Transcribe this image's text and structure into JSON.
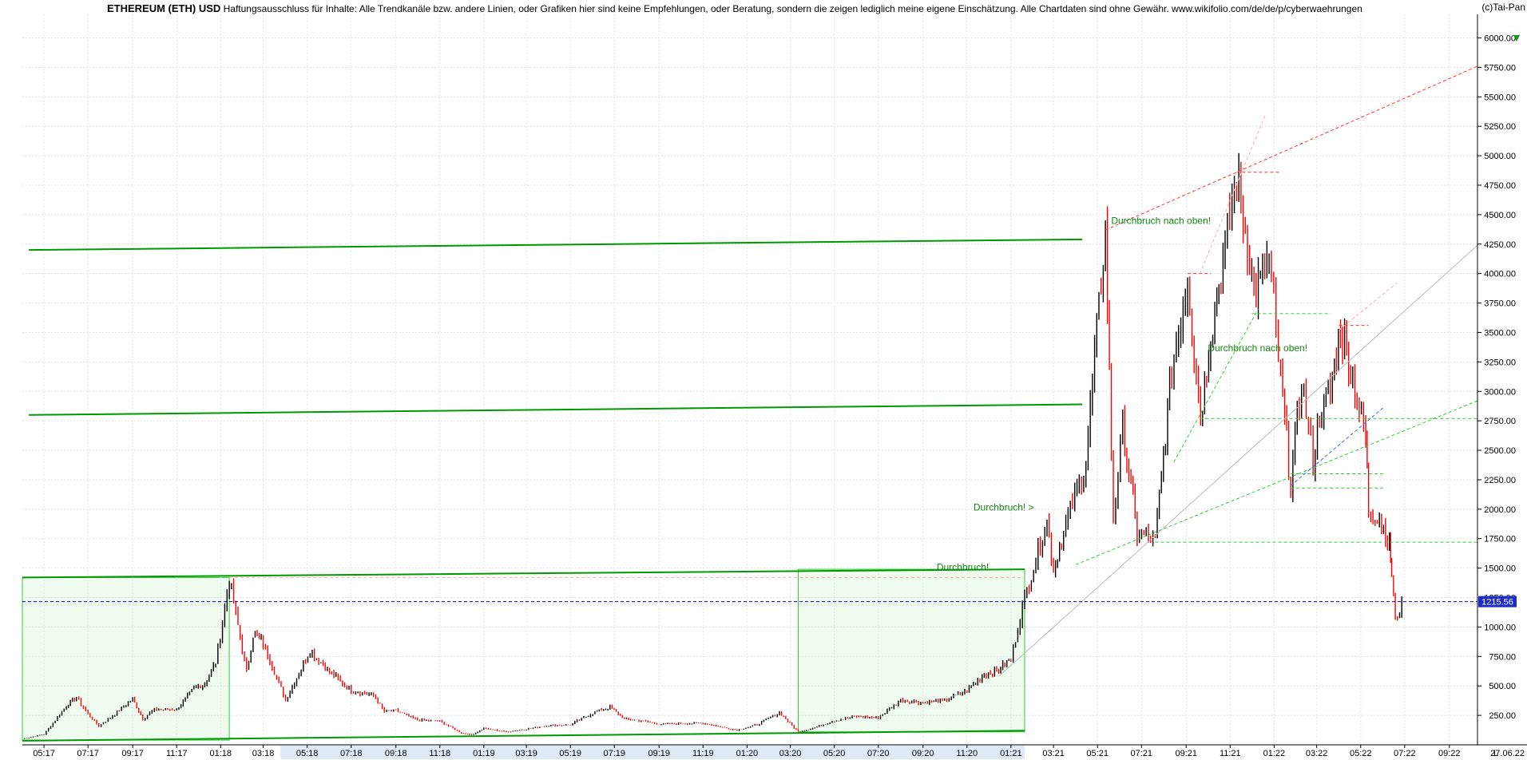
{
  "header": {
    "title": "ETHEREUM (ETH) USD",
    "disclaimer": "Haftungsausschluss für Inhalte: Alle Trendkanäle bzw. andere Linien, oder Grafiken hier sind keine Empfehlungen, oder Beratung, sondern die zeigen lediglich meine eigene Einschätzung. Alle Chartdaten sind ohne Gewähr.  www.wikifolio.com/de/de/p/cyberwaehrungen",
    "copyright": "(c)Tai-Pan"
  },
  "chart_data": {
    "type": "candlestick",
    "title": "ETHEREUM (ETH) USD",
    "ylim": [
      0,
      6200
    ],
    "y_ticks": [
      "250.00",
      "500.00",
      "750.00",
      "1000.00",
      "1250.00",
      "1500.00",
      "1750.00",
      "2000.00",
      "2250.00",
      "2500.00",
      "2750.00",
      "3000.00",
      "3250.00",
      "3500.00",
      "3750.00",
      "4000.00",
      "4250.00",
      "4500.00",
      "4750.00",
      "5000.00",
      "5250.00",
      "5500.00",
      "5750.00",
      "6000.00"
    ],
    "x_range": [
      "2017-04-01",
      "2022-10-10"
    ],
    "x_ticks": [
      {
        "label": "05:17",
        "date": "2017-05-01"
      },
      {
        "label": "07:17",
        "date": "2017-07-01"
      },
      {
        "label": "09:17",
        "date": "2017-09-01"
      },
      {
        "label": "11:17",
        "date": "2017-11-01"
      },
      {
        "label": "01:18",
        "date": "2018-01-01"
      },
      {
        "label": "03:18",
        "date": "2018-03-01"
      },
      {
        "label": "05:18",
        "date": "2018-05-01"
      },
      {
        "label": "07:18",
        "date": "2018-07-01"
      },
      {
        "label": "09:18",
        "date": "2018-09-01"
      },
      {
        "label": "11:18",
        "date": "2018-11-01"
      },
      {
        "label": "01:19",
        "date": "2019-01-01"
      },
      {
        "label": "03:19",
        "date": "2019-03-01"
      },
      {
        "label": "05:19",
        "date": "2019-05-01"
      },
      {
        "label": "07:19",
        "date": "2019-07-01"
      },
      {
        "label": "09:19",
        "date": "2019-09-01"
      },
      {
        "label": "11:19",
        "date": "2019-11-01"
      },
      {
        "label": "01:20",
        "date": "2020-01-01"
      },
      {
        "label": "03:20",
        "date": "2020-03-01"
      },
      {
        "label": "05:20",
        "date": "2020-05-01"
      },
      {
        "label": "07:20",
        "date": "2020-07-01"
      },
      {
        "label": "09:20",
        "date": "2020-09-01"
      },
      {
        "label": "11:20",
        "date": "2020-11-01"
      },
      {
        "label": "01:21",
        "date": "2021-01-01"
      },
      {
        "label": "03:21",
        "date": "2021-03-01"
      },
      {
        "label": "05:21",
        "date": "2021-05-01"
      },
      {
        "label": "07:21",
        "date": "2021-07-01"
      },
      {
        "label": "09:21",
        "date": "2021-09-01"
      },
      {
        "label": "11:21",
        "date": "2021-11-01"
      },
      {
        "label": "01:22",
        "date": "2022-01-01"
      },
      {
        "label": "03:22",
        "date": "2022-03-01"
      },
      {
        "label": "05:22",
        "date": "2022-05-01"
      },
      {
        "label": "07:22",
        "date": "2022-07-01"
      },
      {
        "label": "09:22",
        "date": "2022-09-01"
      }
    ],
    "last_date_label": "27.06.22",
    "axis_marker": "L",
    "last_price": 1215.56,
    "last_price_label": "1215.56",
    "series": [
      {
        "values": [
          [
            "2017-04-01",
            50
          ],
          [
            "2017-05-01",
            90
          ],
          [
            "2017-06-01",
            330
          ],
          [
            "2017-06-15",
            400
          ],
          [
            "2017-07-01",
            260
          ],
          [
            "2017-07-16",
            160
          ],
          [
            "2017-08-01",
            230
          ],
          [
            "2017-09-01",
            390
          ],
          [
            "2017-09-15",
            220
          ],
          [
            "2017-10-01",
            300
          ],
          [
            "2017-11-01",
            300
          ],
          [
            "2017-11-25",
            480
          ],
          [
            "2017-12-10",
            520
          ],
          [
            "2017-12-25",
            700
          ],
          [
            "2018-01-13",
            1400
          ],
          [
            "2018-02-06",
            620
          ],
          [
            "2018-02-15",
            940
          ],
          [
            "2018-03-01",
            860
          ],
          [
            "2018-04-01",
            380
          ],
          [
            "2018-05-05",
            800
          ],
          [
            "2018-06-01",
            620
          ],
          [
            "2018-07-01",
            460
          ],
          [
            "2018-08-01",
            420
          ],
          [
            "2018-08-16",
            280
          ],
          [
            "2018-09-01",
            290
          ],
          [
            "2018-10-01",
            210
          ],
          [
            "2018-11-01",
            200
          ],
          [
            "2018-12-01",
            100
          ],
          [
            "2018-12-15",
            85
          ],
          [
            "2019-01-01",
            140
          ],
          [
            "2019-02-01",
            110
          ],
          [
            "2019-03-01",
            135
          ],
          [
            "2019-04-01",
            165
          ],
          [
            "2019-05-01",
            170
          ],
          [
            "2019-06-01",
            270
          ],
          [
            "2019-06-25",
            320
          ],
          [
            "2019-07-15",
            220
          ],
          [
            "2019-08-01",
            210
          ],
          [
            "2019-09-01",
            175
          ],
          [
            "2019-10-01",
            180
          ],
          [
            "2019-11-01",
            185
          ],
          [
            "2019-12-01",
            145
          ],
          [
            "2019-12-18",
            125
          ],
          [
            "2020-01-15",
            170
          ],
          [
            "2020-02-15",
            275
          ],
          [
            "2020-03-12",
            110
          ],
          [
            "2020-04-01",
            140
          ],
          [
            "2020-05-01",
            205
          ],
          [
            "2020-06-01",
            240
          ],
          [
            "2020-07-01",
            230
          ],
          [
            "2020-08-01",
            380
          ],
          [
            "2020-09-01",
            360
          ],
          [
            "2020-10-01",
            375
          ],
          [
            "2020-11-01",
            460
          ],
          [
            "2020-11-25",
            600
          ],
          [
            "2020-12-15",
            640
          ],
          [
            "2021-01-01",
            730
          ],
          [
            "2021-01-20",
            1250
          ],
          [
            "2021-02-20",
            1900
          ],
          [
            "2021-03-01",
            1500
          ],
          [
            "2021-03-15",
            1800
          ],
          [
            "2021-04-15",
            2400
          ],
          [
            "2021-05-12",
            4360
          ],
          [
            "2021-05-23",
            1900
          ],
          [
            "2021-06-05",
            2700
          ],
          [
            "2021-06-25",
            1800
          ],
          [
            "2021-07-20",
            1730
          ],
          [
            "2021-08-12",
            3200
          ],
          [
            "2021-09-03",
            3950
          ],
          [
            "2021-09-21",
            2800
          ],
          [
            "2021-10-05",
            3500
          ],
          [
            "2021-10-25",
            4200
          ],
          [
            "2021-11-10",
            4850
          ],
          [
            "2021-11-25",
            4300
          ],
          [
            "2021-12-04",
            3800
          ],
          [
            "2021-12-25",
            4100
          ],
          [
            "2022-01-10",
            3100
          ],
          [
            "2022-01-24",
            2200
          ],
          [
            "2022-02-08",
            3100
          ],
          [
            "2022-02-24",
            2400
          ],
          [
            "2022-03-05",
            2800
          ],
          [
            "2022-03-20",
            3000
          ],
          [
            "2022-04-03",
            3550
          ],
          [
            "2022-04-20",
            3100
          ],
          [
            "2022-05-08",
            2600
          ],
          [
            "2022-05-12",
            2000
          ],
          [
            "2022-05-30",
            1900
          ],
          [
            "2022-06-10",
            1700
          ],
          [
            "2022-06-13",
            1450
          ],
          [
            "2022-06-18",
            1050
          ],
          [
            "2022-06-27",
            1215.56
          ]
        ]
      }
    ],
    "annotations": [
      {
        "text": "Durchbruch nach oben!",
        "date": "2021-05-20",
        "value": 4420
      },
      {
        "text": "Durchbruch nach oben!",
        "date": "2021-10-01",
        "value": 3340
      },
      {
        "text": "Durchbruch! >",
        "date": "2020-11-10",
        "value": 1990
      },
      {
        "text": "Durchbruch!",
        "date": "2020-09-20",
        "value": 1480
      }
    ],
    "trendlines": [
      {
        "color": "#009900",
        "style": "solid",
        "from": [
          "2017-04-10",
          4200
        ],
        "to": [
          "2021-04-10",
          4290
        ]
      },
      {
        "color": "#009900",
        "style": "solid",
        "from": [
          "2017-04-10",
          2800
        ],
        "to": [
          "2021-04-10",
          2890
        ]
      },
      {
        "color": "#009900",
        "style": "solid",
        "from": [
          "2017-04-01",
          1420
        ],
        "to": [
          "2021-01-20",
          1490
        ]
      },
      {
        "color": "#009900",
        "style": "solid",
        "from": [
          "2017-04-01",
          35
        ],
        "to": [
          "2021-01-20",
          120
        ]
      },
      {
        "color": "#33cc33",
        "style": "dashed",
        "from": [
          "2021-04-01",
          1530
        ],
        "to": [
          "2022-10-10",
          2920
        ]
      },
      {
        "color": "#33cc33",
        "style": "dashed",
        "from": [
          "2021-07-20",
          1720
        ],
        "to": [
          "2022-10-10",
          1720
        ]
      },
      {
        "color": "#33cc33",
        "style": "dashed",
        "from": [
          "2021-12-01",
          3660
        ],
        "to": [
          "2022-03-20",
          3660
        ]
      },
      {
        "color": "#33cc33",
        "style": "dashed",
        "from": [
          "2021-09-20",
          2770
        ],
        "to": [
          "2022-10-10",
          2770
        ]
      },
      {
        "color": "#33cc33",
        "style": "dashed",
        "from": [
          "2022-01-24",
          2180
        ],
        "to": [
          "2022-06-01",
          2180
        ]
      },
      {
        "color": "#33cc33",
        "style": "dashed",
        "from": [
          "2022-01-24",
          2300
        ],
        "to": [
          "2022-06-01",
          2300
        ]
      },
      {
        "color": "#33cc33",
        "style": "dashed",
        "from": [
          "2021-08-15",
          2400
        ],
        "to": [
          "2021-12-10",
          3700
        ]
      },
      {
        "color": "#ff3333",
        "style": "dashed",
        "from": [
          "2021-05-12",
          4370
        ],
        "to": [
          "2022-10-10",
          5760
        ]
      },
      {
        "color": "#ff3333",
        "style": "dashed",
        "from": [
          "2021-11-10",
          4860
        ],
        "to": [
          "2022-01-10",
          4860
        ]
      },
      {
        "color": "#ff3333",
        "style": "dashed",
        "from": [
          "2022-04-01",
          3560
        ],
        "to": [
          "2022-05-12",
          3560
        ]
      },
      {
        "color": "#ff3333",
        "style": "dashed",
        "from": [
          "2021-09-03",
          4000
        ],
        "to": [
          "2021-10-05",
          4000
        ]
      },
      {
        "color": "#ffaaaa",
        "style": "dashed",
        "from": [
          "2021-09-20",
          4000
        ],
        "to": [
          "2021-12-20",
          5350
        ]
      },
      {
        "color": "#ffaaaa",
        "style": "dashed",
        "from": [
          "2022-04-01",
          3520
        ],
        "to": [
          "2022-06-20",
          3920
        ]
      },
      {
        "color": "#ffaaaa",
        "style": "dashed",
        "from": [
          "2018-01-13",
          1420
        ],
        "to": [
          "2021-01-20",
          1420
        ]
      },
      {
        "color": "#3366ff",
        "style": "dashed",
        "from": [
          "2022-01-24",
          2200
        ],
        "to": [
          "2022-06-01",
          2860
        ]
      },
      {
        "color": "#bbbbbb",
        "style": "solid",
        "from": [
          "2020-12-15",
          580
        ],
        "to": [
          "2022-10-10",
          4240
        ]
      },
      {
        "color": "#0000cc",
        "style": "dashed",
        "from": [
          "2017-04-01",
          1215.56
        ],
        "to": [
          "2022-10-10",
          1215.56
        ]
      }
    ],
    "shaded_boxes": [
      {
        "from": [
          "2017-04-01",
          40
        ],
        "to": [
          "2018-01-13",
          1420
        ]
      },
      {
        "from": [
          "2020-03-12",
          110
        ],
        "to": [
          "2021-01-20",
          1490
        ]
      }
    ],
    "grid": true,
    "colors": {
      "up": "#000000",
      "down": "#ff0000",
      "trend": "#009900"
    }
  }
}
